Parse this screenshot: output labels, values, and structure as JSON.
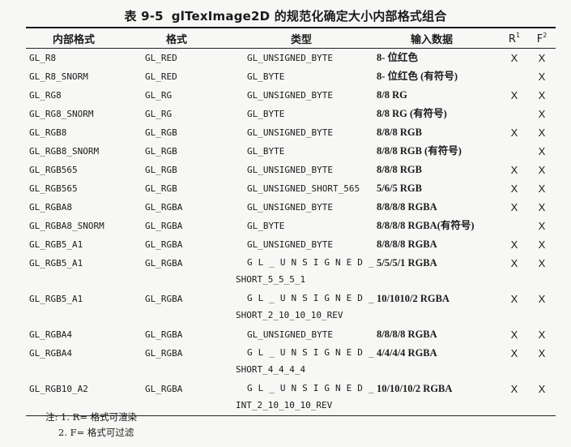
{
  "caption": {
    "number": "表 9-5",
    "title": "glTexImage2D 的规范化确定大小内部格式组合"
  },
  "columns": {
    "internal": "内部格式",
    "format": "格式",
    "type": "类型",
    "input": "输入数据",
    "r": "R",
    "r_sup": "1",
    "f": "F",
    "f_sup": "2"
  },
  "rows": [
    {
      "internal": "GL_R8",
      "format": "GL_RED",
      "type": "GL_UNSIGNED_BYTE",
      "type2": "",
      "input": "8- 位红色",
      "r": "X",
      "f": "X"
    },
    {
      "internal": "GL_R8_SNORM",
      "format": "GL_RED",
      "type": "GL_BYTE",
      "type2": "",
      "input": "8- 位红色 (有符号)",
      "r": "",
      "f": "X"
    },
    {
      "internal": "GL_RG8",
      "format": "GL_RG",
      "type": "GL_UNSIGNED_BYTE",
      "type2": "",
      "input": "8/8 RG",
      "r": "X",
      "f": "X"
    },
    {
      "internal": "GL_RG8_SNORM",
      "format": "GL_RG",
      "type": "GL_BYTE",
      "type2": "",
      "input": "8/8 RG (有符号)",
      "r": "",
      "f": "X"
    },
    {
      "internal": "GL_RGB8",
      "format": "GL_RGB",
      "type": "GL_UNSIGNED_BYTE",
      "type2": "",
      "input": "8/8/8 RGB",
      "r": "X",
      "f": "X"
    },
    {
      "internal": "GL_RGB8_SNORM",
      "format": "GL_RGB",
      "type": "GL_BYTE",
      "type2": "",
      "input": "8/8/8 RGB (有符号)",
      "r": "",
      "f": "X"
    },
    {
      "internal": "GL_RGB565",
      "format": "GL_RGB",
      "type": "GL_UNSIGNED_BYTE",
      "type2": "",
      "input": "8/8/8 RGB",
      "r": "X",
      "f": "X"
    },
    {
      "internal": "GL_RGB565",
      "format": "GL_RGB",
      "type": "GL_UNSIGNED_SHORT_565",
      "type2": "",
      "input": "5/6/5 RGB",
      "r": "X",
      "f": "X"
    },
    {
      "internal": "GL_RGBA8",
      "format": "GL_RGBA",
      "type": "GL_UNSIGNED_BYTE",
      "type2": "",
      "input": "8/8/8/8 RGBA",
      "r": "X",
      "f": "X"
    },
    {
      "internal": "GL_RGBA8_SNORM",
      "format": "GL_RGBA",
      "type": "GL_BYTE",
      "type2": "",
      "input": "8/8/8/8 RGBA(有符号)",
      "r": "",
      "f": "X"
    },
    {
      "internal": "GL_RGB5_A1",
      "format": "GL_RGBA",
      "type": "GL_UNSIGNED_BYTE",
      "type2": "",
      "input": "8/8/8/8 RGBA",
      "r": "X",
      "f": "X"
    },
    {
      "internal": "GL_RGB5_A1",
      "format": "GL_RGBA",
      "type": "GL_UNSIGNED_",
      "type2": "SHORT_5_5_5_1",
      "input": "5/5/5/1 RGBA",
      "r": "X",
      "f": "X"
    },
    {
      "internal": "GL_RGB5_A1",
      "format": "GL_RGBA",
      "type": "GL_UNSIGNED_",
      "type2": "SHORT_2_10_10_10_REV",
      "input": "10/1010/2 RGBA",
      "r": "X",
      "f": "X"
    },
    {
      "internal": "GL_RGBA4",
      "format": "GL_RGBA",
      "type": "GL_UNSIGNED_BYTE",
      "type2": "",
      "input": "8/8/8/8 RGBA",
      "r": "X",
      "f": "X"
    },
    {
      "internal": "GL_RGBA4",
      "format": "GL_RGBA",
      "type": "GL_UNSIGNED_",
      "type2": "SHORT_4_4_4_4",
      "input": "4/4/4/4 RGBA",
      "r": "X",
      "f": "X"
    },
    {
      "internal": "GL_RGB10_A2",
      "format": "GL_RGBA",
      "type": "GL_UNSIGNED_",
      "type2": "INT_2_10_10_10_REV",
      "input": "10/10/10/2 RGBA",
      "r": "X",
      "f": "X"
    }
  ],
  "notes": {
    "label": "注:",
    "line1": "1. R= 格式可渲染",
    "line2": "2. F= 格式可过滤"
  }
}
